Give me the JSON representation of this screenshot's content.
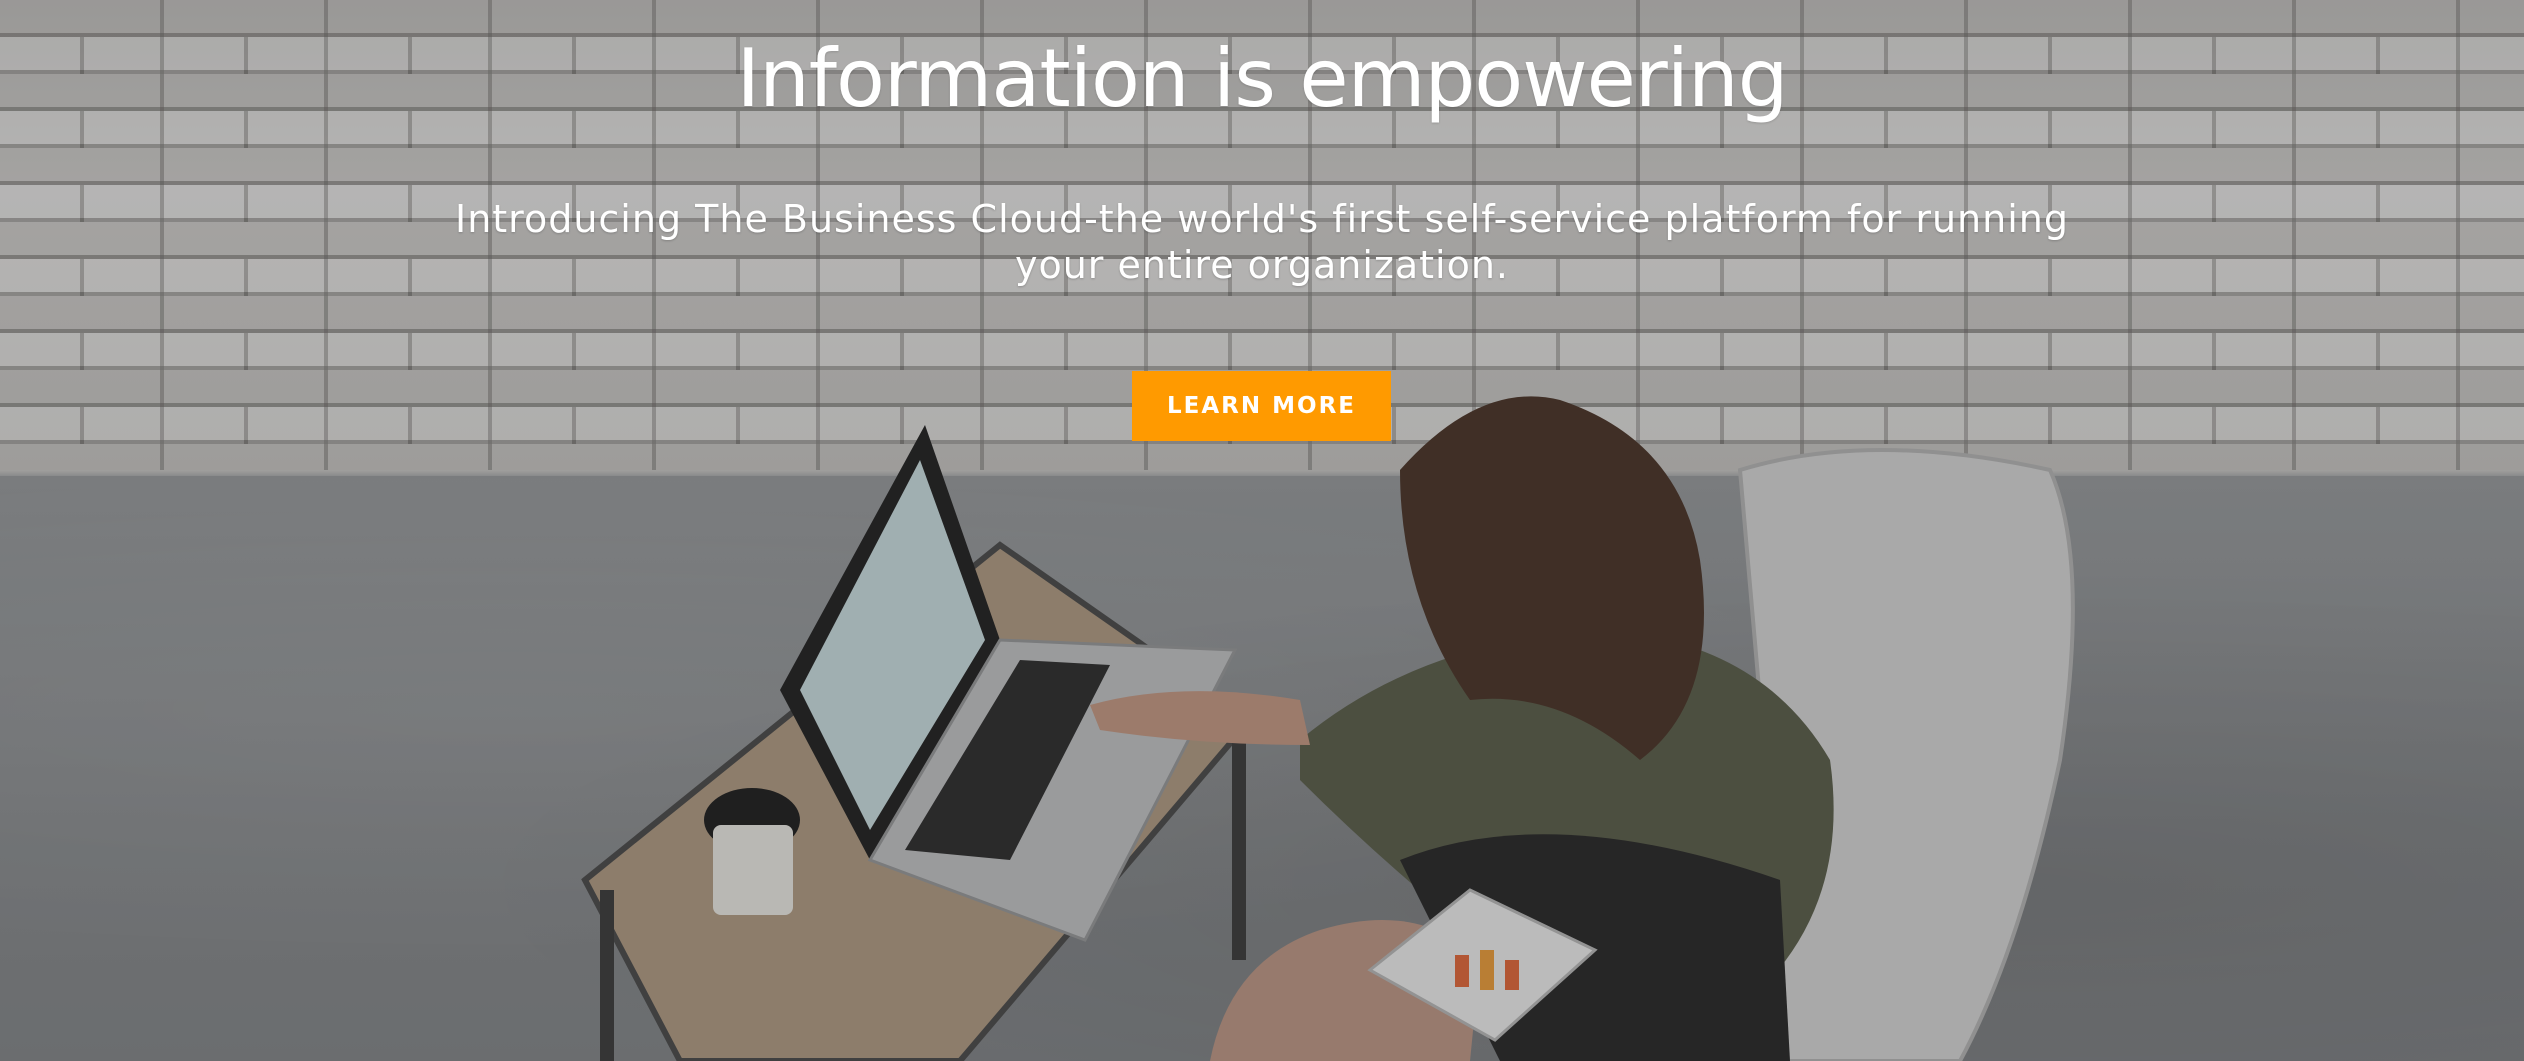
{
  "hero": {
    "headline": "Information is empowering",
    "subtitle": "Introducing The Business Cloud-the world's first self-service platform for running your entire organization.",
    "cta_label": "LEARN MORE"
  },
  "colors": {
    "cta_background": "#ff9a00",
    "text": "#ffffff"
  },
  "background_image": {
    "icon": "photo-woman-working-on-laptop"
  }
}
